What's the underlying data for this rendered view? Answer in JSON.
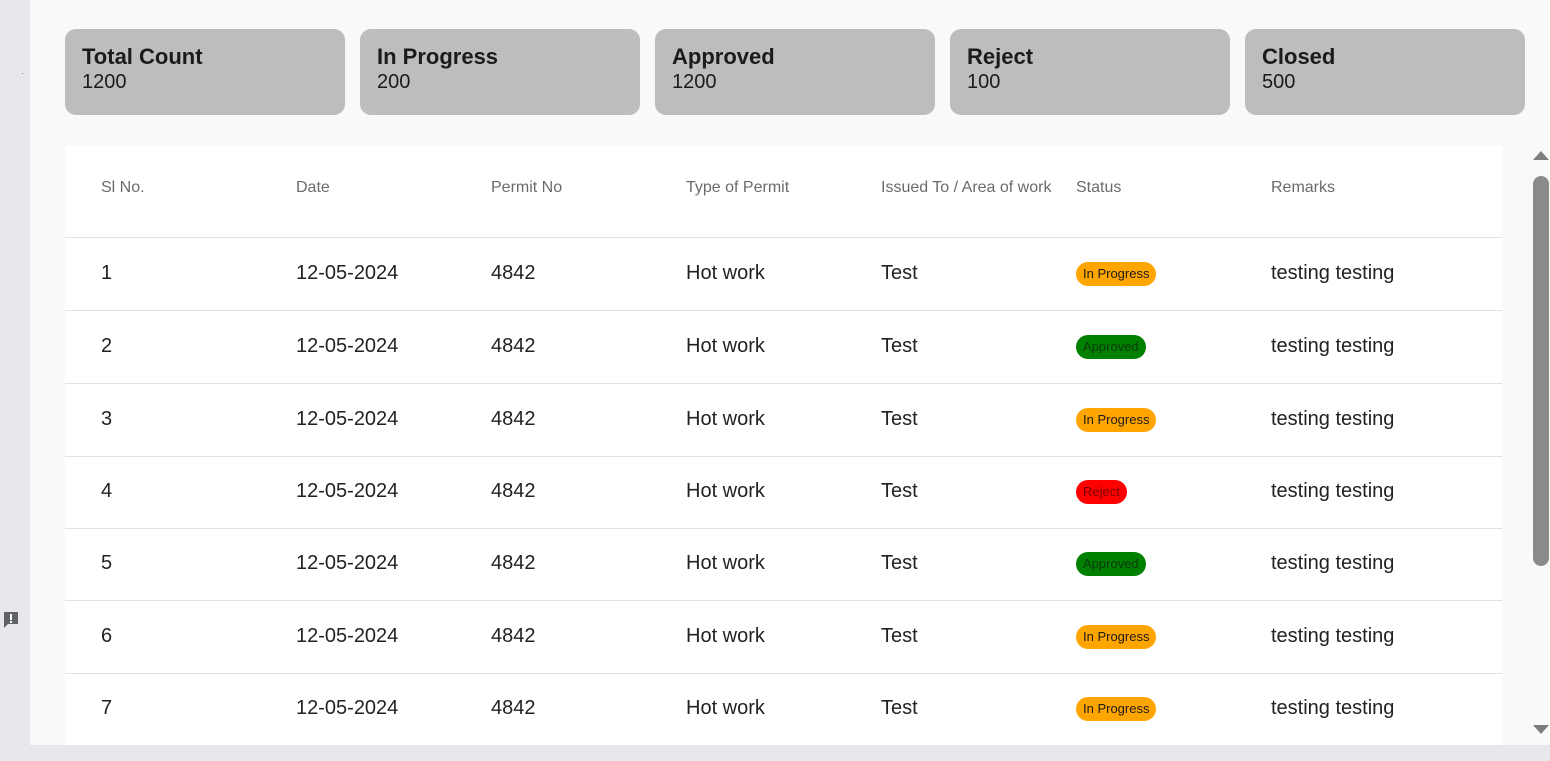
{
  "summary_cards": [
    {
      "title": "Total Count",
      "value": "1200"
    },
    {
      "title": "In Progress",
      "value": "200"
    },
    {
      "title": "Approved",
      "value": "1200"
    },
    {
      "title": "Reject",
      "value": "100"
    },
    {
      "title": "Closed",
      "value": "500"
    }
  ],
  "table": {
    "headers": {
      "sl_no": "Sl No.",
      "date": "Date",
      "permit_no": "Permit No",
      "type_of_permit": "Type of Permit",
      "issued_to": "Issued To / Area of work",
      "status": "Status",
      "remarks": "Remarks"
    },
    "rows": [
      {
        "sl_no": "1",
        "date": "12-05-2024",
        "permit_no": "4842",
        "type": "Hot work",
        "issued_to": "Test",
        "status": "In Progress",
        "remarks": "testing testing"
      },
      {
        "sl_no": "2",
        "date": "12-05-2024",
        "permit_no": "4842",
        "type": "Hot work",
        "issued_to": "Test",
        "status": "Approved",
        "remarks": "testing testing"
      },
      {
        "sl_no": "3",
        "date": "12-05-2024",
        "permit_no": "4842",
        "type": "Hot work",
        "issued_to": "Test",
        "status": "In Progress",
        "remarks": "testing testing"
      },
      {
        "sl_no": "4",
        "date": "12-05-2024",
        "permit_no": "4842",
        "type": "Hot work",
        "issued_to": "Test",
        "status": "Reject",
        "remarks": "testing testing"
      },
      {
        "sl_no": "5",
        "date": "12-05-2024",
        "permit_no": "4842",
        "type": "Hot work",
        "issued_to": "Test",
        "status": "Approved",
        "remarks": "testing testing"
      },
      {
        "sl_no": "6",
        "date": "12-05-2024",
        "permit_no": "4842",
        "type": "Hot work",
        "issued_to": "Test",
        "status": "In Progress",
        "remarks": "testing testing"
      },
      {
        "sl_no": "7",
        "date": "12-05-2024",
        "permit_no": "4842",
        "type": "Hot work",
        "issued_to": "Test",
        "status": "In Progress",
        "remarks": "testing testing"
      }
    ]
  },
  "status_colors": {
    "In Progress": "#ffa500",
    "Approved": "#008000",
    "Reject": "#ff0000"
  },
  "icons": {
    "feedback": "feedback-icon",
    "scroll_up": "scroll-up-arrow-icon",
    "scroll_down": "scroll-down-arrow-icon"
  }
}
